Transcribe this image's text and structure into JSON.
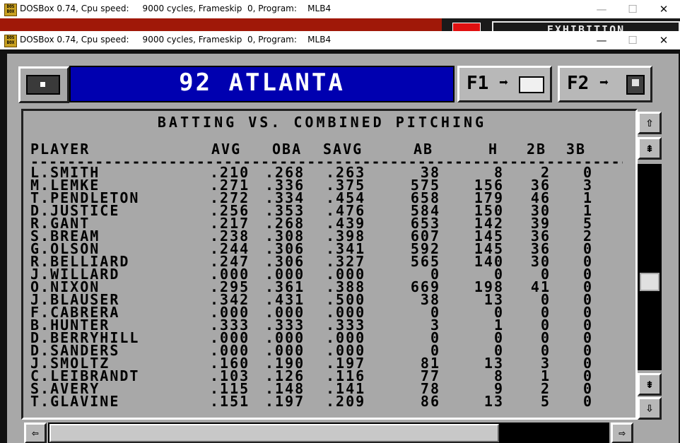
{
  "background_window": {
    "title": "DOSBox 0.74, Cpu speed:     9000 cycles, Frameskip  0, Program:    MLB4",
    "partial_label": "EXHIBITION"
  },
  "window": {
    "title": "DOSBox 0.74, Cpu speed:     9000 cycles, Frameskip  0, Program:    MLB4",
    "logo_text": "DOS BOX",
    "minimize": "—",
    "maximize": "☐",
    "close": "✕"
  },
  "game": {
    "team_title": "92 ATLANTA",
    "f1": {
      "label": "F1",
      "arrow": "➡"
    },
    "f2": {
      "label": "F2",
      "arrow": "➡"
    },
    "heading": "BATTING VS. COMBINED PITCHING",
    "columns": {
      "player": "PLAYER",
      "avg": "AVG",
      "oba": "OBA",
      "savg": "SAVG",
      "ab": "AB",
      "h": "H",
      "2b": "2B",
      "3b": "3B"
    },
    "dashes": "-------------------------------------------------------------------------------------",
    "rows": [
      {
        "name": "L.SMITH",
        "avg": ".210",
        "oba": ".268",
        "savg": ".263",
        "ab": "38",
        "h": "8",
        "b2": "2",
        "b3": "0"
      },
      {
        "name": "M.LEMKE",
        "avg": ".271",
        "oba": ".336",
        "savg": ".375",
        "ab": "575",
        "h": "156",
        "b2": "36",
        "b3": "3"
      },
      {
        "name": "T.PENDLETON",
        "avg": ".272",
        "oba": ".334",
        "savg": ".454",
        "ab": "658",
        "h": "179",
        "b2": "46",
        "b3": "1"
      },
      {
        "name": "D.JUSTICE",
        "avg": ".256",
        "oba": ".353",
        "savg": ".476",
        "ab": "584",
        "h": "150",
        "b2": "30",
        "b3": "1"
      },
      {
        "name": "R.GANT",
        "avg": ".217",
        "oba": ".268",
        "savg": ".439",
        "ab": "653",
        "h": "142",
        "b2": "39",
        "b3": "5"
      },
      {
        "name": "S.BREAM",
        "avg": ".238",
        "oba": ".308",
        "savg": ".398",
        "ab": "607",
        "h": "145",
        "b2": "36",
        "b3": "2"
      },
      {
        "name": "G.OLSON",
        "avg": ".244",
        "oba": ".306",
        "savg": ".341",
        "ab": "592",
        "h": "145",
        "b2": "36",
        "b3": "0"
      },
      {
        "name": "R.BELLIARD",
        "avg": ".247",
        "oba": ".306",
        "savg": ".327",
        "ab": "565",
        "h": "140",
        "b2": "30",
        "b3": "0"
      },
      {
        "name": "J.WILLARD",
        "avg": ".000",
        "oba": ".000",
        "savg": ".000",
        "ab": "0",
        "h": "0",
        "b2": "0",
        "b3": "0"
      },
      {
        "name": "O.NIXON",
        "avg": ".295",
        "oba": ".361",
        "savg": ".388",
        "ab": "669",
        "h": "198",
        "b2": "41",
        "b3": "0"
      },
      {
        "name": "J.BLAUSER",
        "avg": ".342",
        "oba": ".431",
        "savg": ".500",
        "ab": "38",
        "h": "13",
        "b2": "0",
        "b3": "0"
      },
      {
        "name": "F.CABRERA",
        "avg": ".000",
        "oba": ".000",
        "savg": ".000",
        "ab": "0",
        "h": "0",
        "b2": "0",
        "b3": "0"
      },
      {
        "name": "B.HUNTER",
        "avg": ".333",
        "oba": ".333",
        "savg": ".333",
        "ab": "3",
        "h": "1",
        "b2": "0",
        "b3": "0"
      },
      {
        "name": "D.BERRYHILL",
        "avg": ".000",
        "oba": ".000",
        "savg": ".000",
        "ab": "0",
        "h": "0",
        "b2": "0",
        "b3": "0"
      },
      {
        "name": "D.SANDERS",
        "avg": ".000",
        "oba": ".000",
        "savg": ".000",
        "ab": "0",
        "h": "0",
        "b2": "0",
        "b3": "0"
      },
      {
        "name": "J.SMOLTZ",
        "avg": ".160",
        "oba": ".190",
        "savg": ".197",
        "ab": "81",
        "h": "13",
        "b2": "3",
        "b3": "0"
      },
      {
        "name": "C.LEIBRANDT",
        "avg": ".103",
        "oba": ".126",
        "savg": ".116",
        "ab": "77",
        "h": "8",
        "b2": "1",
        "b3": "0"
      },
      {
        "name": "S.AVERY",
        "avg": ".115",
        "oba": ".148",
        "savg": ".141",
        "ab": "78",
        "h": "9",
        "b2": "2",
        "b3": "0"
      },
      {
        "name": "T.GLAVINE",
        "avg": ".151",
        "oba": ".197",
        "savg": ".209",
        "ab": "86",
        "h": "13",
        "b2": "5",
        "b3": "0"
      }
    ],
    "scroll": {
      "up": "⇧",
      "page_up": "⇞",
      "page_down": "⇟",
      "down": "⇩",
      "left": "⇦",
      "right": "⇨"
    }
  }
}
